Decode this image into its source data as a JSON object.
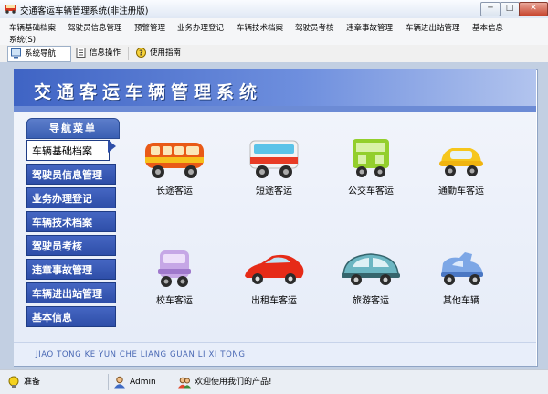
{
  "window": {
    "title": "交通客运车辆管理系统(非注册版)",
    "controls": {
      "minimize": "─",
      "maximize": "□",
      "close": "✕"
    }
  },
  "menu": [
    "车辆基础档案",
    "驾驶员信息管理",
    "预警管理",
    "业务办理登记",
    "车辆技术档案",
    "驾驶员考核",
    "违章事故管理",
    "车辆进出站管理",
    "基本信息",
    "系统(S)"
  ],
  "toolbar": {
    "system_nav": "系统导航",
    "info_ops": "信息操作",
    "user_guide": "使用指南"
  },
  "banner": {
    "title": "交通客运车辆管理系统",
    "pinyin": "JIAO TONG KE YUN CHE LIANG GUAN LI XI TONG"
  },
  "nav": {
    "header": "导航菜单",
    "items": [
      "车辆基础档案",
      "驾驶员信息管理",
      "业务办理登记",
      "车辆技术档案",
      "驾驶员考核",
      "违章事故管理",
      "车辆进出站管理",
      "基本信息"
    ]
  },
  "vehicles": [
    "长途客运",
    "短途客运",
    "公交车客运",
    "通勤车客运",
    "校车客运",
    "出租车客运",
    "旅游客运",
    "其他车辆"
  ],
  "status": {
    "state": "准备",
    "user": "Admin",
    "welcome": "欢迎使用我们的产品!"
  },
  "colors": {
    "banner": "#4a6fcb",
    "nav": "#3557b0",
    "footer_text": "#4867b3"
  }
}
